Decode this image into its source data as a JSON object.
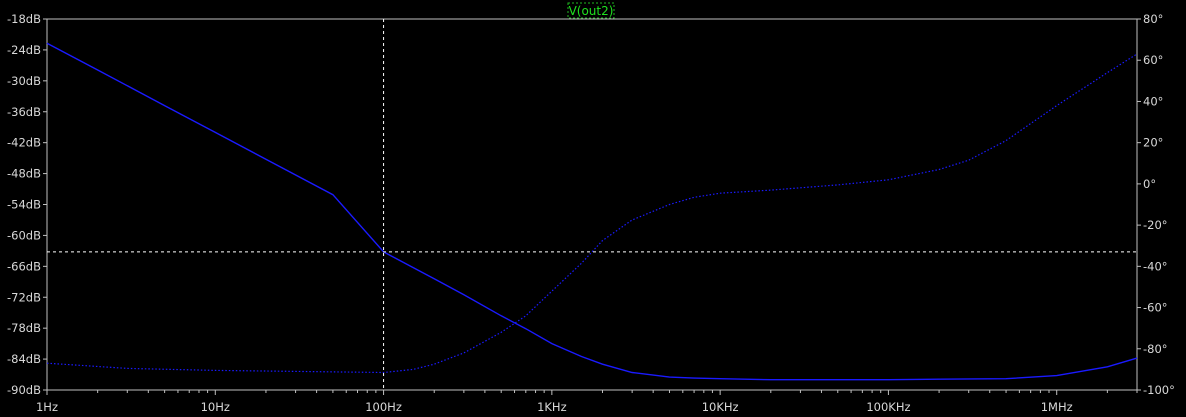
{
  "chart_data": {
    "type": "line",
    "title": "",
    "legend": {
      "label": "V(out2)",
      "placement": "top-center"
    },
    "xscale": "log",
    "xlim": [
      1,
      3000000
    ],
    "x_ticks": [
      {
        "v": 1,
        "label": "1Hz"
      },
      {
        "v": 10,
        "label": "10Hz"
      },
      {
        "v": 100,
        "label": "100Hz"
      },
      {
        "v": 1000,
        "label": "1KHz"
      },
      {
        "v": 10000,
        "label": "10KHz"
      },
      {
        "v": 100000,
        "label": "100KHz"
      },
      {
        "v": 1000000,
        "label": "1MHz"
      }
    ],
    "ylim": [
      -90,
      -18
    ],
    "y_ticks": [
      {
        "v": -18,
        "label": "-18dB"
      },
      {
        "v": -24,
        "label": "-24dB"
      },
      {
        "v": -30,
        "label": "-30dB"
      },
      {
        "v": -36,
        "label": "-36dB"
      },
      {
        "v": -42,
        "label": "-42dB"
      },
      {
        "v": -48,
        "label": "-48dB"
      },
      {
        "v": -54,
        "label": "-54dB"
      },
      {
        "v": -60,
        "label": "-60dB"
      },
      {
        "v": -66,
        "label": "-66dB"
      },
      {
        "v": -72,
        "label": "-72dB"
      },
      {
        "v": -78,
        "label": "-78dB"
      },
      {
        "v": -84,
        "label": "-84dB"
      },
      {
        "v": -90,
        "label": "-90dB"
      }
    ],
    "y2lim": [
      -100,
      80
    ],
    "y2_ticks": [
      {
        "v": 80,
        "label": "80°"
      },
      {
        "v": 60,
        "label": "60°"
      },
      {
        "v": 40,
        "label": "40°"
      },
      {
        "v": 20,
        "label": "20°"
      },
      {
        "v": 0,
        "label": "0°"
      },
      {
        "v": -20,
        "label": "-20°"
      },
      {
        "v": -40,
        "label": "-40°"
      },
      {
        "v": -60,
        "label": "-60°"
      },
      {
        "v": -80,
        "label": "-80°"
      },
      {
        "v": -100,
        "label": "-100°"
      }
    ],
    "cursor": {
      "x": 100,
      "y": -63.2
    },
    "colors": {
      "background": "#000000",
      "trace": "#1a1aff",
      "axis": "#c0c0c0",
      "label": "#d8d8d8",
      "cursor": "#ffffff",
      "legend": "#1fe01f"
    },
    "series": [
      {
        "axis": "left",
        "style": "solid",
        "x": [
          1,
          2,
          5,
          10,
          20,
          50,
          100,
          200,
          300,
          500,
          700,
          1000,
          1500,
          2000,
          3000,
          5000,
          7000,
          10000,
          20000,
          50000,
          100000,
          200000,
          500000,
          1000000,
          2000000,
          3000000
        ],
        "y": [
          -22.7,
          -27.9,
          -34.8,
          -40.0,
          -45.2,
          -52.1,
          -63.2,
          -68.4,
          -71.5,
          -75.6,
          -78.1,
          -81.0,
          -83.5,
          -85.0,
          -86.6,
          -87.5,
          -87.7,
          -87.8,
          -88.0,
          -88.0,
          -88.0,
          -87.9,
          -87.8,
          -87.2,
          -85.5,
          -83.8
        ]
      },
      {
        "axis": "right",
        "style": "dotted",
        "x": [
          1,
          3,
          10,
          30,
          100,
          150,
          200,
          300,
          500,
          700,
          1000,
          1500,
          2000,
          3000,
          5000,
          7000,
          10000,
          20000,
          50000,
          100000,
          200000,
          300000,
          500000,
          1000000,
          2000000,
          3000000
        ],
        "y": [
          -87.0,
          -89.5,
          -90.5,
          -91.0,
          -91.5,
          -90.0,
          -87.5,
          -82.0,
          -72.0,
          -64.0,
          -52.0,
          -38.5,
          -27.5,
          -17.5,
          -10.0,
          -6.5,
          -4.5,
          -3.0,
          -0.5,
          2.0,
          7.0,
          11.5,
          21.0,
          38.0,
          54.0,
          63.0
        ]
      }
    ]
  }
}
